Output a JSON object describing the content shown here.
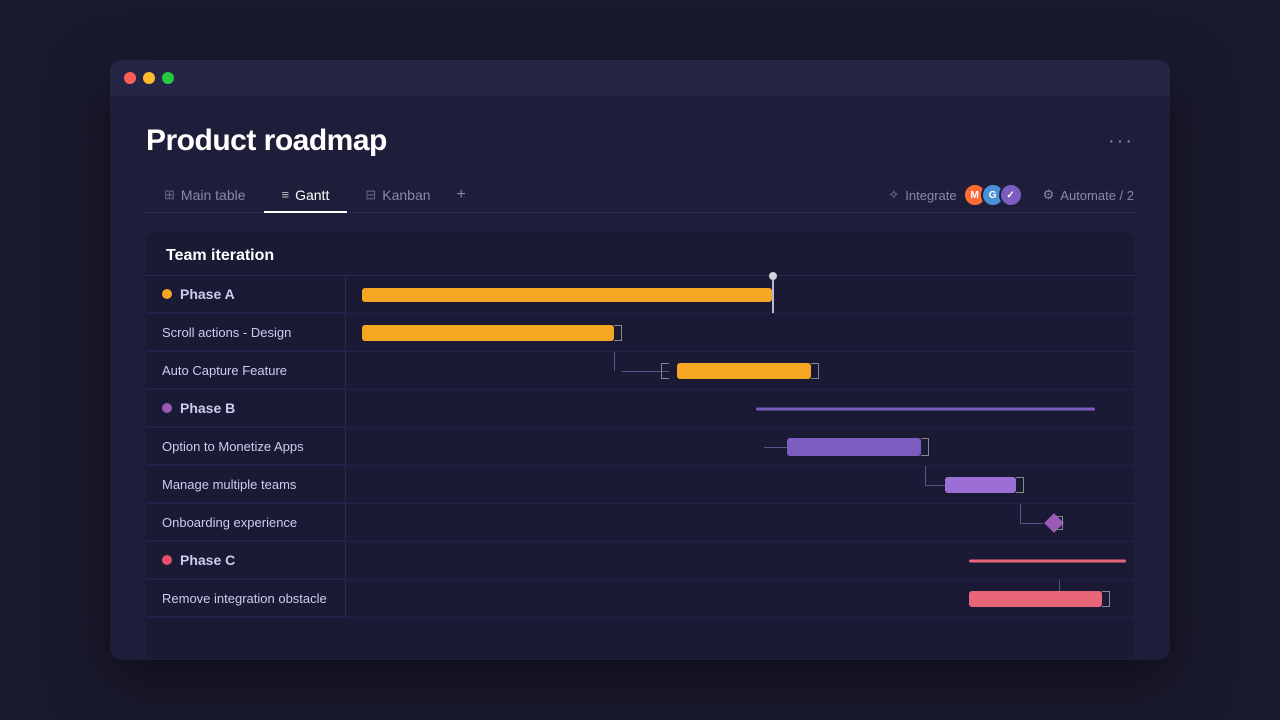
{
  "window": {
    "title": "Product roadmap"
  },
  "tabs": [
    {
      "id": "main-table",
      "label": "Main table",
      "icon": "⊞",
      "active": false
    },
    {
      "id": "gantt",
      "label": "Gantt",
      "icon": "≡",
      "active": true
    },
    {
      "id": "kanban",
      "label": "Kanban",
      "icon": "⊟",
      "active": false
    }
  ],
  "actions": {
    "integrate": "Integrate",
    "automate": "Automate / 2",
    "plus": "+"
  },
  "gantt": {
    "section_title": "Team iteration",
    "phases": [
      {
        "id": "phase-a",
        "label": "Phase A",
        "color": "orange",
        "tasks": [
          {
            "label": "Scroll actions - Design"
          },
          {
            "label": "Auto Capture Feature"
          }
        ]
      },
      {
        "id": "phase-b",
        "label": "Phase B",
        "color": "purple",
        "tasks": [
          {
            "label": "Option to Monetize Apps"
          },
          {
            "label": "Manage multiple teams"
          },
          {
            "label": "Onboarding experience"
          }
        ]
      },
      {
        "id": "phase-c",
        "label": "Phase C",
        "color": "red",
        "tasks": [
          {
            "label": "Remove integration obstacle"
          }
        ]
      }
    ]
  }
}
